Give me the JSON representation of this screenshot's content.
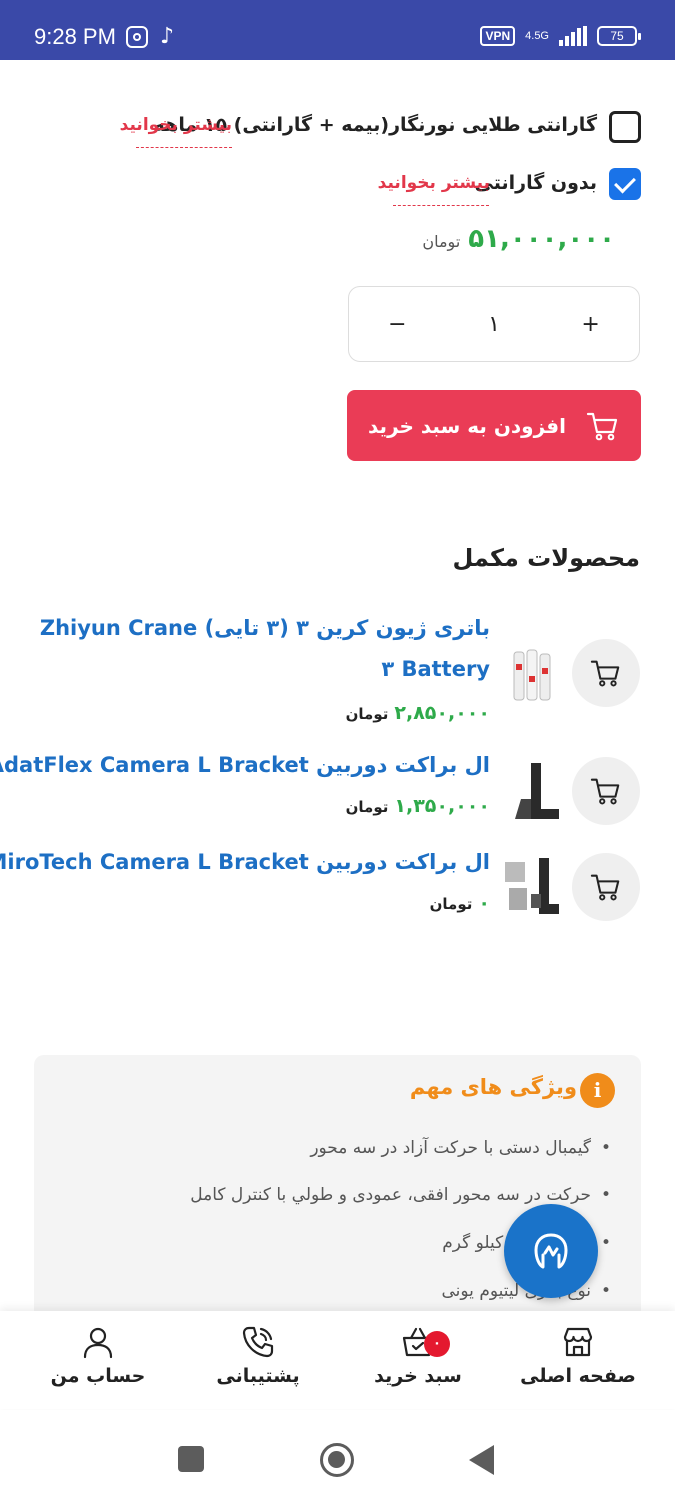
{
  "status_bar": {
    "time": "9:28 PM",
    "vpn": "VPN",
    "network": "4.5G",
    "battery": "75"
  },
  "warranty": {
    "option1_label": "گارانتی طلایی نورنگار(بیمه + گارانتی) ۱۵ ماهه",
    "option1_more": "بیشتر بخوانید",
    "option1_checked": false,
    "option2_label": "بدون گارانتی",
    "option2_more": "بیشتر بخوانید",
    "option2_checked": true
  },
  "price": {
    "value": "۵۱,۰۰۰,۰۰۰",
    "unit": "تومان"
  },
  "quantity": {
    "minus": "−",
    "value": "۱",
    "plus": "+"
  },
  "add_to_cart": {
    "label": "افزودن به سبد خرید"
  },
  "related": {
    "title": "محصولات مکمل",
    "items": [
      {
        "title": "باتری ژیون کرین ۳ (۳ تایی) Zhiyun Crane ۳ Battery",
        "price": "۲,۸۵۰,۰۰۰",
        "unit": "تومان"
      },
      {
        "title": "ال براکت دوربین AdatFlex Camera L Bracket",
        "price": "۱,۳۵۰,۰۰۰",
        "unit": "تومان"
      },
      {
        "title": "ال براکت دوربین MiroTech Camera L Bracket",
        "price": "۰",
        "unit": "تومان"
      }
    ]
  },
  "features": {
    "title": "ویژگی های مهم",
    "items": [
      "گیمبال دستی با حرکت آزاد در سه محور",
      "حرکت در سه محور افقی، عمودی و طولي با کنترل کامل",
      "تحمل: ۶.۴۶ کیلو گرم",
      "نوع باتری لیتیوم یونی"
    ]
  },
  "bottom_nav": {
    "home": "صفحه اصلی",
    "cart": "سبد خرید",
    "cart_badge": "۰",
    "support": "پشتیبانی",
    "account": "حساب من"
  },
  "colors": {
    "status_bar": "#3a49a8",
    "accent_red": "#ea3c56",
    "price_green": "#2eaa4a",
    "link_blue": "#1d6fc4",
    "feature_orange": "#f08c1a",
    "fab_blue": "#1a73c9"
  }
}
